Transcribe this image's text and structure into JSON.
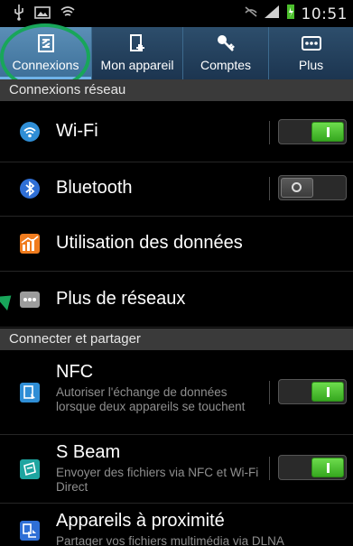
{
  "status_bar": {
    "time": "10:51",
    "left_icons": [
      "usb-icon",
      "image-icon",
      "voicemail-icon"
    ],
    "right_icons": [
      "mute-icon",
      "signal-icon",
      "battery-charging-icon"
    ]
  },
  "tabs": [
    {
      "label": "Connexions",
      "icon": "connections-icon",
      "active": true
    },
    {
      "label": "Mon appareil",
      "icon": "device-icon",
      "active": false
    },
    {
      "label": "Comptes",
      "icon": "key-icon",
      "active": false
    },
    {
      "label": "Plus",
      "icon": "more-icon",
      "active": false
    }
  ],
  "sections": {
    "network": "Connexions réseau",
    "share": "Connecter et partager"
  },
  "items": {
    "wifi": {
      "title": "Wi-Fi",
      "icon": "wifi-icon",
      "toggle": "on"
    },
    "bluetooth": {
      "title": "Bluetooth",
      "icon": "bluetooth-icon",
      "toggle": "off"
    },
    "data_usage": {
      "title": "Utilisation des données",
      "icon": "data-usage-icon"
    },
    "more_networks": {
      "title": "Plus de réseaux",
      "icon": "more-networks-icon"
    },
    "nfc": {
      "title": "NFC",
      "subtitle": "Autoriser l'échange de données lorsque deux appareils se touchent",
      "icon": "nfc-icon",
      "toggle": "on"
    },
    "s_beam": {
      "title": "S Beam",
      "subtitle": "Envoyer des fichiers via NFC et Wi-Fi Direct",
      "icon": "s-beam-icon",
      "toggle": "on"
    },
    "nearby": {
      "title": "Appareils à proximité",
      "subtitle": "Partager vos fichiers multimédia via DLNA",
      "icon": "nearby-devices-icon"
    }
  },
  "colors": {
    "tab_bar": "#1c3550",
    "tab_active": "#3d6f98",
    "toggle_on": "#36a81f",
    "section_header": "#3a3a3a",
    "highlight_ring": "#18a65a"
  }
}
